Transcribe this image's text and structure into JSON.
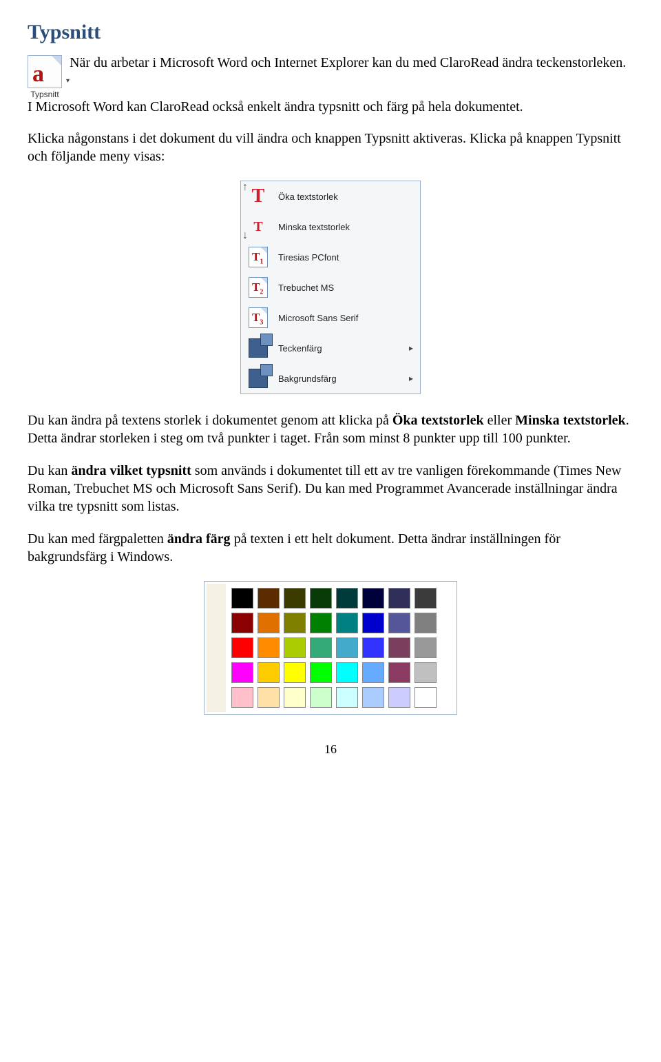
{
  "title": "Typsnitt",
  "toolbutton": {
    "label": "Typsnitt"
  },
  "para1_a": "När du arbetar i Microsoft Word och Internet Explorer kan du med ClaroRead ändra teckenstorleken. I Microsoft Word kan ClaroRead också enkelt ändra typsnitt och färg på hela dokumentet.",
  "para2": "Klicka någonstans i det dokument du vill ändra och knappen Typsnitt aktiveras. Klicka på knappen Typsnitt och följande meny visas:",
  "menu": {
    "items": [
      {
        "label": "Öka textstorlek"
      },
      {
        "label": "Minska textstorlek"
      },
      {
        "label": "Tiresias PCfont"
      },
      {
        "label": "Trebuchet MS"
      },
      {
        "label": "Microsoft Sans Serif"
      },
      {
        "label": "Teckenfärg"
      },
      {
        "label": "Bakgrundsfärg"
      }
    ]
  },
  "para3_a": "Du kan ändra på textens storlek i dokumentet genom att klicka på ",
  "para3_b": "Öka textstorlek",
  "para3_c": " eller ",
  "para3_d": "Minska textstorlek",
  "para3_e": ". Detta ändrar storleken i steg om två punkter i taget. Från som minst 8 punkter upp till 100 punkter.",
  "para4_a": "Du kan ",
  "para4_b": "ändra vilket typsnitt",
  "para4_c": " som används i dokumentet till ett av tre vanligen förekommande (Times New Roman, Trebuchet MS och Microsoft Sans Serif). Du kan med Programmet Avancerade inställningar ändra vilka tre typsnitt som listas.",
  "para5_a": "Du kan med färgpaletten ",
  "para5_b": "ändra färg",
  "para5_c": " på texten i ett helt dokument. Detta ändrar inställningen för bakgrundsfärg i Windows.",
  "palette": {
    "colors": [
      "#000000",
      "#5b2c00",
      "#3b3b00",
      "#093b09",
      "#003b3b",
      "#00003b",
      "#2f2f5a",
      "#3b3b3b",
      "#8b0000",
      "#e07000",
      "#808000",
      "#008000",
      "#008080",
      "#0000cd",
      "#555599",
      "#808080",
      "#ff0000",
      "#ff8c00",
      "#aacc00",
      "#33aa77",
      "#44aacc",
      "#3333ff",
      "#7b3f5e",
      "#999999",
      "#ff00ff",
      "#ffcc00",
      "#ffff00",
      "#00ff00",
      "#00ffff",
      "#66aaff",
      "#8b3a62",
      "#c0c0c0",
      "#ffc0cb",
      "#ffe0a6",
      "#ffffcc",
      "#ccffcc",
      "#ccffff",
      "#aaccff",
      "#ccccff",
      "#ffffff"
    ]
  },
  "page_number": "16"
}
